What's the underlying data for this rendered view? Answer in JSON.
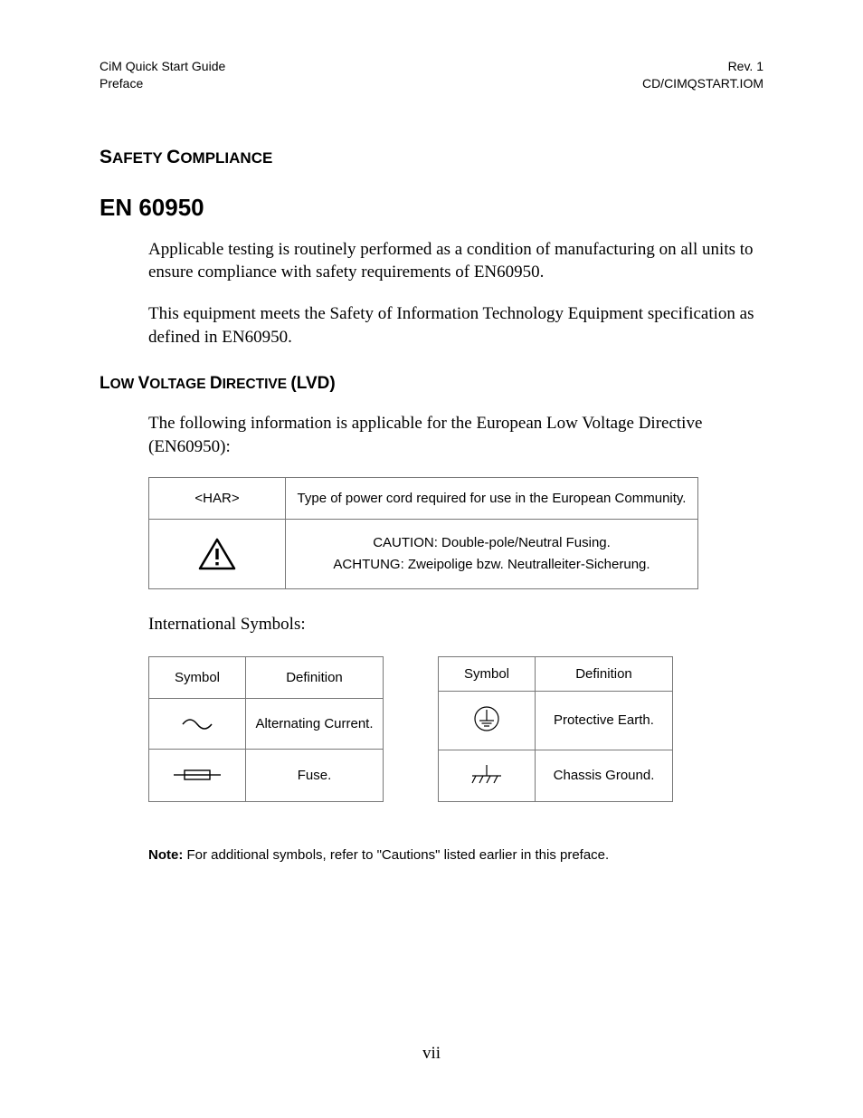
{
  "header": {
    "left_line1": "CiM Quick Start Guide",
    "left_line2": "Preface",
    "right_line1": "Rev. 1",
    "right_line2": "CD/CIMQSTART.IOM"
  },
  "section_title": "SAFETY COMPLIANCE",
  "en_heading": "EN 60950",
  "para1": "Applicable testing is routinely performed as a condition of manufacturing on all units to ensure compliance with safety requirements of EN60950.",
  "para2": "This equipment meets the Safety of Information Technology Equipment specification as defined in EN60950.",
  "lvd_heading": "LOW VOLTAGE DIRECTIVE (LVD)",
  "lvd_intro": "The following information is applicable for the European Low Voltage Directive (EN60950):",
  "lvd_table": {
    "row1": {
      "symbol": "<HAR>",
      "text": "Type of power cord required for use in the European Community."
    },
    "row2": {
      "line1": "CAUTION: Double-pole/Neutral Fusing.",
      "line2": "ACHTUNG: Zweipolige bzw. Neutralleiter-Sicherung."
    }
  },
  "intl_label": "International Symbols:",
  "symtable_headers": {
    "symbol": "Symbol",
    "definition": "Definition"
  },
  "left_table": {
    "row1": "Alternating Current.",
    "row2": "Fuse."
  },
  "right_table": {
    "row1": "Protective Earth.",
    "row2": "Chassis Ground."
  },
  "note_label": "Note:",
  "note_text": " For additional symbols, refer to \"Cautions\" listed earlier in this preface.",
  "page_number": "vii"
}
